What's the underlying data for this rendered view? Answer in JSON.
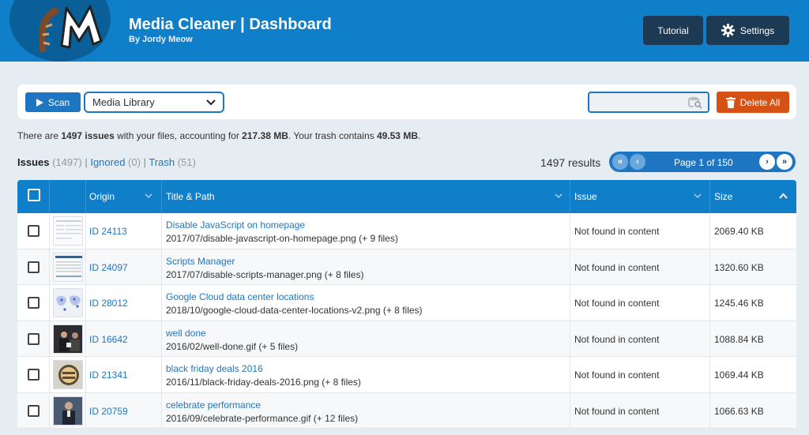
{
  "header": {
    "title": "Media Cleaner | Dashboard",
    "subtitle": "By Jordy Meow",
    "tutorial_label": "Tutorial",
    "settings_label": "Settings"
  },
  "toolbar": {
    "scan_label": "Scan",
    "library_select": "Media Library",
    "search_placeholder": "",
    "delete_all_label": "Delete All"
  },
  "summary": {
    "prefix": "There are ",
    "issues": "1497 issues",
    "mid": " with your files, accounting for ",
    "size": "217.38 MB",
    "mid2": ". Your trash contains ",
    "trash": "49.53 MB",
    "suffix": "."
  },
  "tabs": {
    "issues_label": "Issues",
    "issues_count": "(1497)",
    "ignored_label": "Ignored",
    "ignored_count": "(0)",
    "trash_label": "Trash",
    "trash_count": "(51)",
    "separator": "|"
  },
  "results_text": "1497 results",
  "pager": {
    "page_text": "Page 1 of 150",
    "first": "«",
    "prev": "‹",
    "next": "›",
    "last": "»"
  },
  "table": {
    "columns": [
      "Origin",
      "Title & Path",
      "Issue",
      "Size"
    ],
    "rows": [
      {
        "origin": "ID 24113",
        "title": "Disable JavaScript on homepage",
        "path": "2017/07/disable-javascript-on-homepage.png (+ 9 files)",
        "issue": "Not found in content",
        "size": "2069.40 KB"
      },
      {
        "origin": "ID 24097",
        "title": "Scripts Manager",
        "path": "2017/07/disable-scripts-manager.png (+ 8 files)",
        "issue": "Not found in content",
        "size": "1320.60 KB"
      },
      {
        "origin": "ID 28012",
        "title": "Google Cloud data center locations",
        "path": "2018/10/google-cloud-data-center-locations-v2.png (+ 8 files)",
        "issue": "Not found in content",
        "size": "1245.46 KB"
      },
      {
        "origin": "ID 16642",
        "title": "well done",
        "path": "2016/02/well-done.gif (+ 5 files)",
        "issue": "Not found in content",
        "size": "1088.84 KB"
      },
      {
        "origin": "ID 21341",
        "title": "black friday deals 2016",
        "path": "2016/11/black-friday-deals-2016.png (+ 8 files)",
        "issue": "Not found in content",
        "size": "1069.44 KB"
      },
      {
        "origin": "ID 20759",
        "title": "celebrate performance",
        "path": "2016/09/celebrate-performance.gif (+ 12 files)",
        "issue": "Not found in content",
        "size": "1066.63 KB"
      }
    ]
  },
  "colors": {
    "brand": "#107fc9",
    "danger": "#d55214",
    "dark_button": "#1d3a55"
  }
}
